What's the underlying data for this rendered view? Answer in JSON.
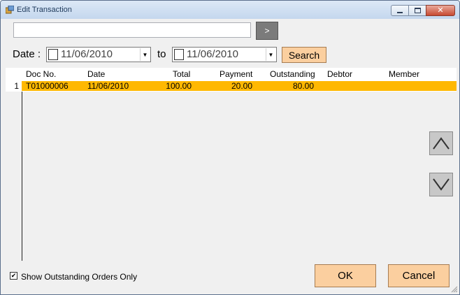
{
  "window": {
    "title": "Edit Transaction"
  },
  "search": {
    "value": "",
    "go_label": ">"
  },
  "filter": {
    "date_label": "Date :",
    "from_date": "11/06/2010",
    "to_label": "to",
    "to_date": "11/06/2010",
    "search_label": "Search"
  },
  "grid": {
    "columns": [
      "Doc No.",
      "Date",
      "Total",
      "Payment",
      "Outstanding",
      "Debtor",
      "Member"
    ],
    "rows": [
      {
        "num": "1",
        "doc_no": "T01000006",
        "date": "11/06/2010",
        "total": "100.00",
        "payment": "20.00",
        "outstanding": "80.00",
        "debtor": "",
        "member": ""
      }
    ],
    "selected_color": "#ffb800"
  },
  "options": {
    "show_outstanding_label": "Show Outstanding Orders Only",
    "show_outstanding_checked": true
  },
  "buttons": {
    "ok_label": "OK",
    "cancel_label": "Cancel"
  },
  "colors": {
    "accent_button": "#fbcf9f",
    "selected_row": "#ffb800"
  }
}
